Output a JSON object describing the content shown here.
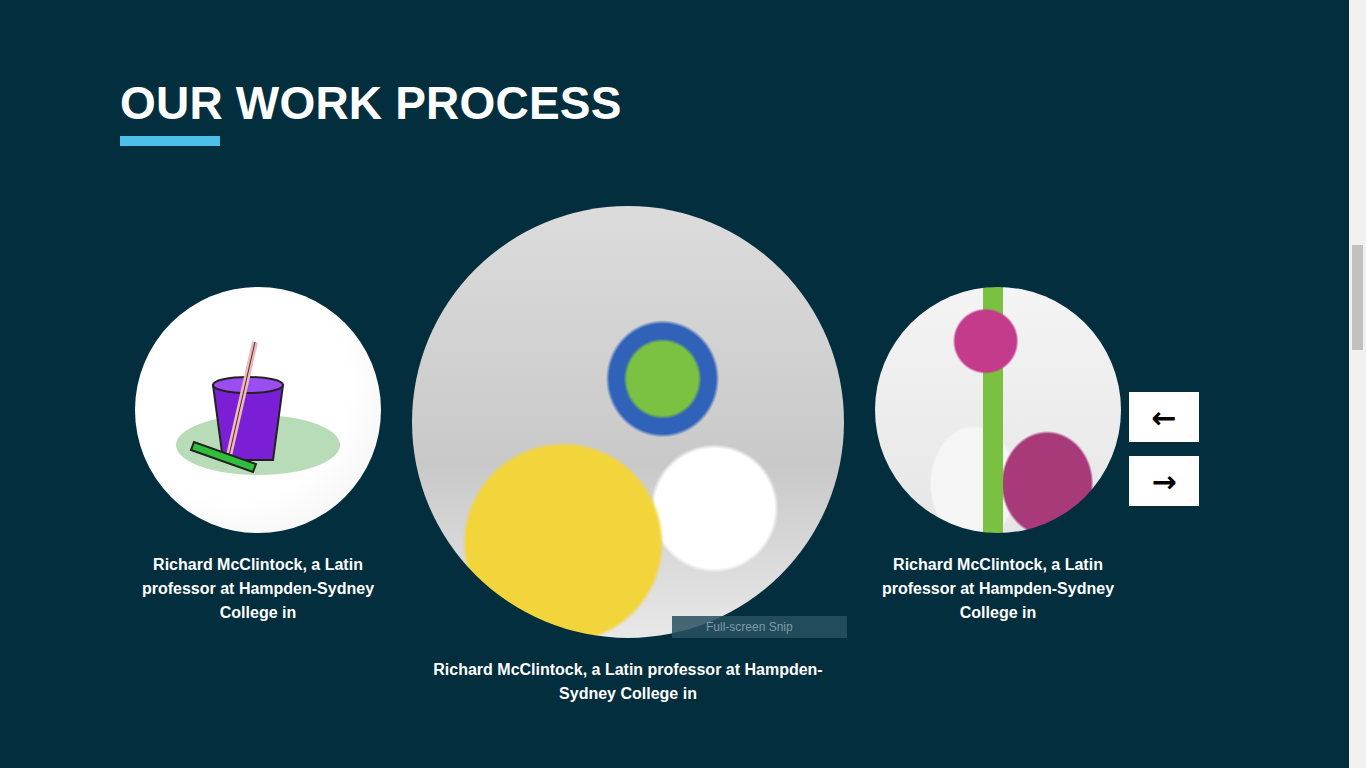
{
  "section": {
    "title": "OUR WORK PROCESS"
  },
  "items": [
    {
      "caption": "Richard McClintock, a Latin professor at Hampden-Sydney College in",
      "selected": false
    },
    {
      "caption": "Richard McClintock, a Latin professor at Hampden-Sydney College in",
      "selected": true
    },
    {
      "caption": "Richard McClintock, a Latin professor at Hampden-Sydney College in",
      "selected": false
    }
  ],
  "buttons": [
    "←",
    "→"
  ],
  "tooltip": "Full-screen Snip"
}
